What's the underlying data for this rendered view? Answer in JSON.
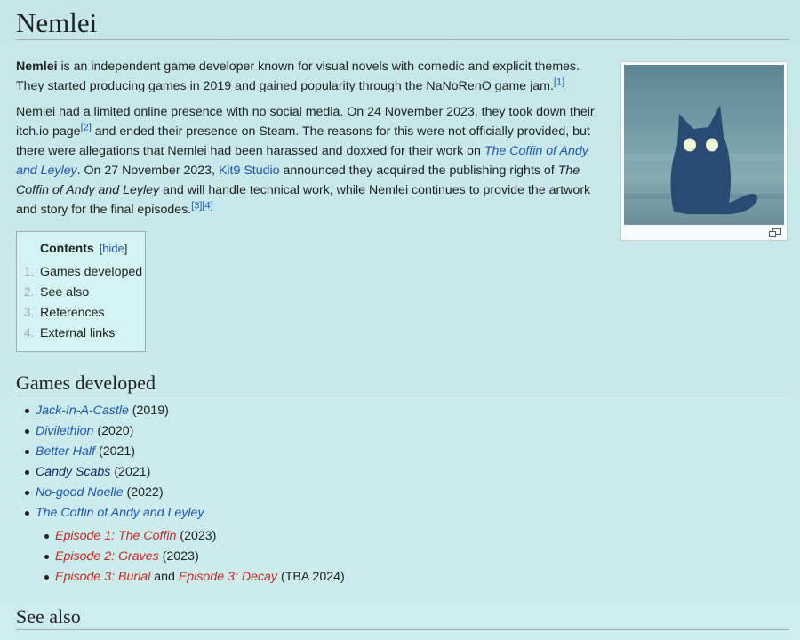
{
  "page": {
    "title": "Nemlei"
  },
  "intro": {
    "p1": {
      "bold": "Nemlei",
      "text": " is an independent game developer known for visual novels with comedic and explicit themes. They started producing games in 2019 and gained popularity through the NaNoRenO game jam.",
      "ref1": "[1]"
    },
    "p2": {
      "t1": "Nemlei had a limited online presence with no social media. On 24 November 2023, they took down their itch.io page",
      "ref2": "[2]",
      "t2": " and ended their presence on Steam. The reasons for this were not officially provided, but there were allegations that Nemlei had been harassed and doxxed for their work on ",
      "link1": "The Coffin of Andy and Leyley",
      "t3": ". On 27 November 2023, ",
      "link2": "Kit9 Studio",
      "t4": " announced they acquired the publishing rights of ",
      "ital": "The Coffin of Andy and Leyley",
      "t5": " and will handle technical work, while Nemlei continues to provide the artwork and story for the final episodes.",
      "ref3": "[3]",
      "ref4": "[4]"
    }
  },
  "toc": {
    "title": "Contents",
    "hide_open": "[",
    "hide_label": "hide",
    "hide_close": "]",
    "items": [
      {
        "num": "1.",
        "label": "Games developed"
      },
      {
        "num": "2.",
        "label": "See also"
      },
      {
        "num": "3.",
        "label": "References"
      },
      {
        "num": "4.",
        "label": "External links"
      }
    ]
  },
  "sections": {
    "games_heading": "Games developed",
    "see_also_heading": "See also"
  },
  "games": [
    {
      "title": "Jack-In-A-Castle",
      "year": " (2019)"
    },
    {
      "title": "Divilethion",
      "year": " (2020)"
    },
    {
      "title": "Better Half",
      "year": " (2021)"
    },
    {
      "title": "Candy Scabs",
      "year": " (2021)"
    },
    {
      "title": "No-good Noelle",
      "year": " (2022)"
    },
    {
      "title": "The Coffin of Andy and Leyley",
      "year": ""
    }
  ],
  "episodes": [
    {
      "title": "Episode 1: The Coffin",
      "year": " (2023)"
    },
    {
      "title": "Episode 2: Graves",
      "year": " (2023)"
    },
    {
      "title": "Episode 3: Burial",
      "and": " and ",
      "title2": "Episode 3: Decay",
      "year": " (TBA 2024)"
    }
  ],
  "colors": {
    "link": "#1d55ad",
    "visited_link": "#0d2769",
    "redlink": "#c22b25",
    "background": "#c9eaea"
  },
  "icons": {
    "thumbnail": "cat-silhouette-image",
    "enlarge": "magnify-icon"
  }
}
